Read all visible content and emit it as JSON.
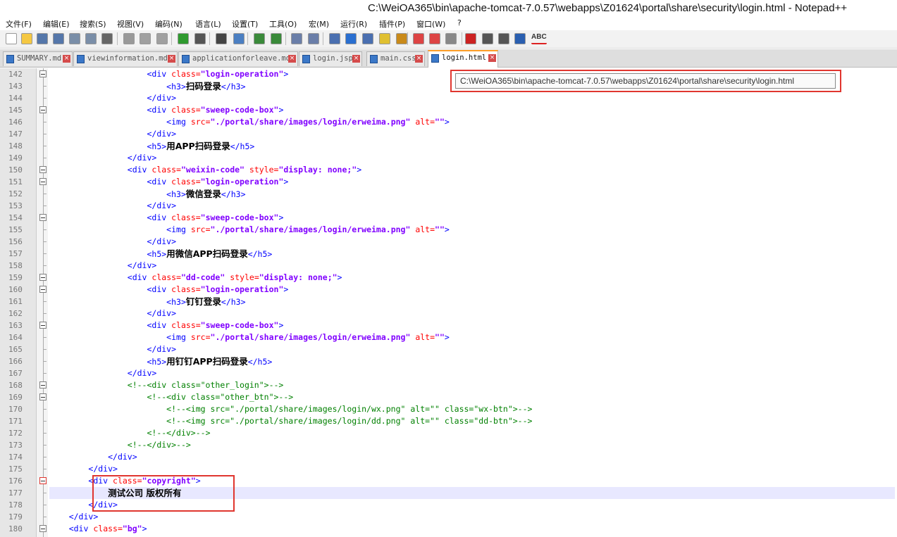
{
  "window": {
    "title": "C:\\WeiOA365\\bin\\apache-tomcat-7.0.57\\webapps\\Z01624\\portal\\share\\security\\login.html - Notepad++"
  },
  "menu": [
    "文件(F)",
    "编辑(E)",
    "搜索(S)",
    "视图(V)",
    "编码(N)",
    "语言(L)",
    "设置(T)",
    "工具(O)",
    "宏(M)",
    "运行(R)",
    "插件(P)",
    "窗口(W)",
    "?"
  ],
  "toolbar": {
    "icons": [
      "new-file-icon",
      "open-file-icon",
      "save-icon",
      "save-all-icon",
      "close-icon",
      "close-all-icon",
      "print-icon",
      "cut-icon",
      "copy-icon",
      "paste-icon",
      "undo-icon",
      "redo-icon",
      "find-icon",
      "replace-icon",
      "zoom-in-icon",
      "zoom-out-icon",
      "sync-v-icon",
      "sync-h-icon",
      "wrap-icon",
      "show-all-chars-icon",
      "indent-guide-icon",
      "doc-map-icon",
      "function-list-icon",
      "folder-icon",
      "monitor-icon",
      "record-icon",
      "stop-icon",
      "play-icon",
      "play-multi-icon",
      "save-macro-icon",
      "spellcheck-icon"
    ],
    "spell_label": "ABC"
  },
  "tabs": [
    {
      "label": "SUMMARY.md",
      "active": false
    },
    {
      "label": "viewinformation.md",
      "active": false
    },
    {
      "label": "applicationforleave.md",
      "active": false
    },
    {
      "label": "login.jsp",
      "active": false
    },
    {
      "label": "main.css",
      "active": false
    },
    {
      "label": "login.html",
      "active": true
    }
  ],
  "tooltip": {
    "path": "C:\\WeiOA365\\bin\\apache-tomcat-7.0.57\\webapps\\Z01624\\portal\\share\\security\\login.html"
  },
  "editor": {
    "lines": [
      {
        "n": 142,
        "indent": 20,
        "code": "<div class=\"login-operation\">"
      },
      {
        "n": 143,
        "indent": 24,
        "code": "<h3>扫码登录</h3>"
      },
      {
        "n": 144,
        "indent": 20,
        "code": "</div>"
      },
      {
        "n": 145,
        "indent": 20,
        "code": "<div class=\"sweep-code-box\">"
      },
      {
        "n": 146,
        "indent": 24,
        "code": "<img src=\"./portal/share/images/login/erweima.png\" alt=\"\">"
      },
      {
        "n": 147,
        "indent": 20,
        "code": "</div>"
      },
      {
        "n": 148,
        "indent": 20,
        "code": "<h5>用APP扫码登录</h5>"
      },
      {
        "n": 149,
        "indent": 16,
        "code": "</div>"
      },
      {
        "n": 150,
        "indent": 16,
        "code": "<div class=\"weixin-code\" style=\"display: none;\">"
      },
      {
        "n": 151,
        "indent": 20,
        "code": "<div class=\"login-operation\">"
      },
      {
        "n": 152,
        "indent": 24,
        "code": "<h3>微信登录</h3>"
      },
      {
        "n": 153,
        "indent": 20,
        "code": "</div>"
      },
      {
        "n": 154,
        "indent": 20,
        "code": "<div class=\"sweep-code-box\">"
      },
      {
        "n": 155,
        "indent": 24,
        "code": "<img src=\"./portal/share/images/login/erweima.png\" alt=\"\">"
      },
      {
        "n": 156,
        "indent": 20,
        "code": "</div>"
      },
      {
        "n": 157,
        "indent": 20,
        "code": "<h5>用微信APP扫码登录</h5>"
      },
      {
        "n": 158,
        "indent": 16,
        "code": "</div>"
      },
      {
        "n": 159,
        "indent": 16,
        "code": "<div class=\"dd-code\" style=\"display: none;\">"
      },
      {
        "n": 160,
        "indent": 20,
        "code": "<div class=\"login-operation\">"
      },
      {
        "n": 161,
        "indent": 24,
        "code": "<h3>钉钉登录</h3>"
      },
      {
        "n": 162,
        "indent": 20,
        "code": "</div>"
      },
      {
        "n": 163,
        "indent": 20,
        "code": "<div class=\"sweep-code-box\">"
      },
      {
        "n": 164,
        "indent": 24,
        "code": "<img src=\"./portal/share/images/login/erweima.png\" alt=\"\">"
      },
      {
        "n": 165,
        "indent": 20,
        "code": "</div>"
      },
      {
        "n": 166,
        "indent": 20,
        "code": "<h5>用钉钉APP扫码登录</h5>"
      },
      {
        "n": 167,
        "indent": 16,
        "code": "</div>"
      },
      {
        "n": 168,
        "indent": 16,
        "code": "<!--<div class=\"other_login\">-->"
      },
      {
        "n": 169,
        "indent": 20,
        "code": "<!--<div class=\"other_btn\">-->"
      },
      {
        "n": 170,
        "indent": 24,
        "code": "<!--<img src=\"./portal/share/images/login/wx.png\" alt=\"\" class=\"wx-btn\">-->"
      },
      {
        "n": 171,
        "indent": 24,
        "code": "<!--<img src=\"./portal/share/images/login/dd.png\" alt=\"\" class=\"dd-btn\">-->"
      },
      {
        "n": 172,
        "indent": 20,
        "code": "<!--</div>-->"
      },
      {
        "n": 173,
        "indent": 16,
        "code": "<!--</div>-->"
      },
      {
        "n": 174,
        "indent": 12,
        "code": "</div>"
      },
      {
        "n": 175,
        "indent": 8,
        "code": "</div>"
      },
      {
        "n": 176,
        "indent": 8,
        "code": "<div class=\"copyright\">"
      },
      {
        "n": 177,
        "indent": 12,
        "code": "测试公司 版权所有"
      },
      {
        "n": 178,
        "indent": 8,
        "code": "</div>"
      },
      {
        "n": 179,
        "indent": 4,
        "code": "</div>"
      },
      {
        "n": 180,
        "indent": 4,
        "code": "<div class=\"bg\">"
      }
    ]
  },
  "colors": {
    "tag": "#0000ff",
    "attr": "#ff0000",
    "string": "#8000ff",
    "comment": "#008000",
    "highlight": "#e0362f",
    "tab_active": "#ff9f28"
  }
}
